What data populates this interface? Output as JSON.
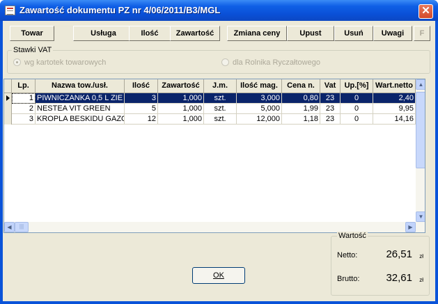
{
  "window": {
    "title": "Zawartość dokumentu PZ nr 4/06/2011/B3/MGL",
    "close_label": "✕"
  },
  "toolbar": {
    "buttons": [
      {
        "label": "Towar"
      },
      {
        "label": "Usługa"
      },
      {
        "label": "Ilość"
      },
      {
        "label": "Zawartość"
      },
      {
        "label": "Zmiana ceny"
      },
      {
        "label": "Upust"
      },
      {
        "label": "Usuń"
      },
      {
        "label": "Uwagi"
      },
      {
        "label": "F"
      }
    ]
  },
  "vat": {
    "legend": "Stawki VAT",
    "option1": "wg kartotek towarowych",
    "option2": "dla Rolnika Ryczałtowego",
    "selected": "option1"
  },
  "grid": {
    "headers": {
      "lp": "Lp.",
      "name": "Nazwa tow./usł.",
      "qty": "Ilość",
      "content": "Zawartość",
      "unit": "J.m.",
      "qty_store": "Ilość mag.",
      "price": "Cena n.",
      "vat": "Vat",
      "disc": "Up.[%]",
      "net": "Wart.netto"
    },
    "rows": [
      {
        "lp": "1",
        "name": "PIWNICZANKA 0,5 L ZIE",
        "qty": "3",
        "content": "1,000",
        "unit": "szt.",
        "qty_store": "3,000",
        "price": "0,80",
        "vat": "23",
        "disc": "0",
        "net": "2,40"
      },
      {
        "lp": "2",
        "name": "NESTEA  VIT  GREEN",
        "qty": "5",
        "content": "1,000",
        "unit": "szt.",
        "qty_store": "5,000",
        "price": "1,99",
        "vat": "23",
        "disc": "0",
        "net": "9,95"
      },
      {
        "lp": "3",
        "name": "KROPLA BESKIDU GAZO",
        "qty": "12",
        "content": "1,000",
        "unit": "szt.",
        "qty_store": "12,000",
        "price": "1,18",
        "vat": "23",
        "disc": "0",
        "net": "14,16"
      }
    ],
    "selected_row": 0
  },
  "ok_button": {
    "label": "OK"
  },
  "value": {
    "legend": "Wartość",
    "net_label": "Netto:",
    "net_value": "26,51",
    "net_currency": "zł",
    "gross_label": "Brutto:",
    "gross_value": "32,61",
    "gross_currency": "zł"
  },
  "colors": {
    "titlebar": "#0a53d9",
    "selection": "#0a246a",
    "face": "#ece9d8"
  }
}
